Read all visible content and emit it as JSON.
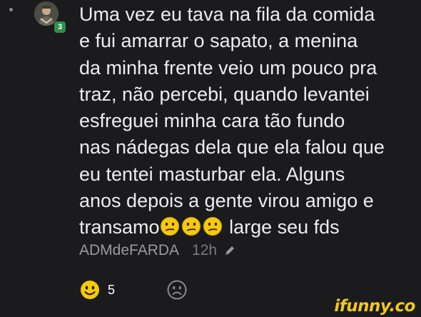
{
  "comment": {
    "author": "ADMdeFARDA",
    "level_badge": "3",
    "time": "12h",
    "lines": [
      "Uma vez eu tava na fila da comida",
      "e fui amarrar o sapato, a menina",
      "da minha frente veio um pouco pra",
      "traz, não percebi, quando levantei",
      "esfreguei minha cara tão fundo",
      "nas nádegas dela que ela falou que",
      "eu tentei masturbar ela. Alguns",
      "anos depois a gente virou amigo e"
    ],
    "last_line_start": "transamo",
    "last_line_end": " large seu fds",
    "emojis": [
      "confused-face-emoji",
      "confused-face-emoji",
      "confused-face-emoji"
    ]
  },
  "actions": {
    "smile_count": "5",
    "smile_icon": "smile-icon",
    "frown_icon": "frown-icon"
  },
  "watermark": "ifunny.co",
  "colors": {
    "background": "#1b1b1d",
    "text": "#ededed",
    "meta": "#9a9a9a",
    "badge": "#2f8f4e",
    "smile": "#f6c90e",
    "watermark": "#f2c81b"
  }
}
